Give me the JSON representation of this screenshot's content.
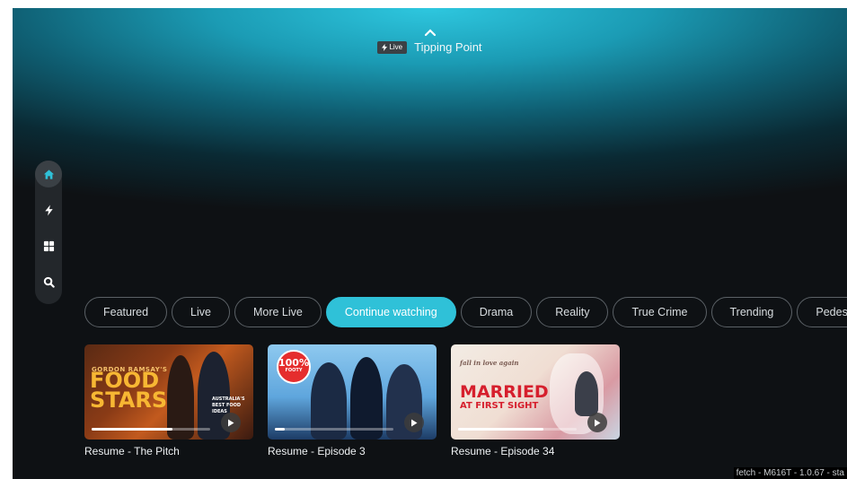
{
  "hero": {
    "live_badge": "Live",
    "title": "Tipping Point"
  },
  "sidebar": {
    "items": [
      {
        "icon": "home-icon",
        "active": true
      },
      {
        "icon": "lightning-icon",
        "active": false
      },
      {
        "icon": "grid-icon",
        "active": false
      },
      {
        "icon": "search-icon",
        "active": false
      }
    ]
  },
  "categories": [
    {
      "label": "Featured"
    },
    {
      "label": "Live"
    },
    {
      "label": "More Live"
    },
    {
      "label": "Continue watching",
      "active": true
    },
    {
      "label": "Drama"
    },
    {
      "label": "Reality"
    },
    {
      "label": "True Crime"
    },
    {
      "label": "Trending"
    },
    {
      "label": "Pedestrian TV"
    }
  ],
  "cards": [
    {
      "title": "Resume - The Pitch",
      "progress": 0.68,
      "art": {
        "line1": "GORDON RAMSAY'S",
        "line2": "FOOD",
        "line3": "STARS",
        "side": "AUSTRALIA'S BEST FOOD IDEAS"
      }
    },
    {
      "title": "Resume - Episode 3",
      "progress": 0.08,
      "art": {
        "badge_top": "100%",
        "badge_bottom": "FOOTY"
      }
    },
    {
      "title": "Resume - Episode 34",
      "progress": 0.72,
      "art": {
        "tagline": "fall in love again",
        "line1": "MARRIED",
        "line2": "AT FIRST SIGHT"
      }
    }
  ],
  "footer": {
    "text": "fetch - M616T - 1.0.67 - sta"
  },
  "colors": {
    "accent": "#2fc1d8",
    "background": "#0e1114"
  }
}
